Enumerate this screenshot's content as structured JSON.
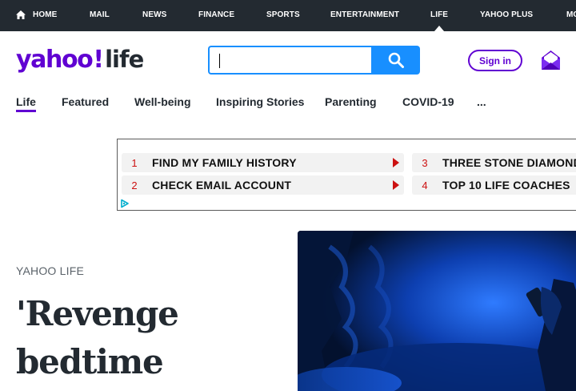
{
  "topnav": {
    "items": [
      "HOME",
      "MAIL",
      "NEWS",
      "FINANCE",
      "SPORTS",
      "ENTERTAINMENT",
      "LIFE",
      "YAHOO PLUS",
      "MO"
    ],
    "active": "LIFE"
  },
  "header": {
    "logo_text_1": "yahoo",
    "logo_text_2": "!",
    "logo_text_3": "life",
    "search_value": "",
    "signin_label": "Sign in"
  },
  "subnav": {
    "items": [
      "Life",
      "Featured",
      "Well-being",
      "Inspiring Stories",
      "Parenting",
      "COVID-19",
      "..."
    ]
  },
  "ad": {
    "items": [
      {
        "num": "1",
        "text": "FIND MY FAMILY HISTORY"
      },
      {
        "num": "2",
        "text": "CHECK EMAIL ACCOUNT"
      },
      {
        "num": "3",
        "text": "THREE STONE DIAMOND"
      },
      {
        "num": "4",
        "text": "TOP 10 LIFE COACHES"
      }
    ]
  },
  "article": {
    "kicker": "YAHOO LIFE",
    "headline": "'Revenge bedtime"
  },
  "colors": {
    "brand": "#6001d2",
    "search": "#188fff",
    "topnav_bg": "#232a31",
    "ad_number": "#cc1111"
  },
  "icons": [
    "home-icon",
    "search-icon",
    "mail-icon",
    "ad-choices-icon",
    "ad-arrow-icon"
  ]
}
